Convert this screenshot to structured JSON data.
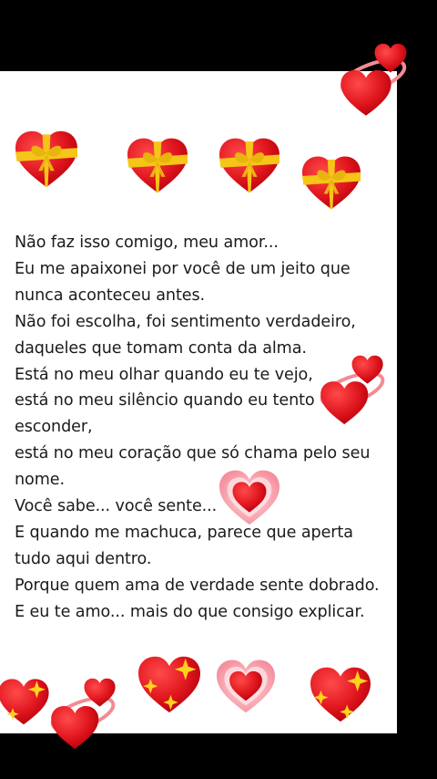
{
  "poem_lines": [
    "Não faz isso comigo, meu amor...",
    "Eu me apaixonei por você de um jeito que",
    "nunca aconteceu antes.",
    "Não foi escolha, foi sentimento verdadeiro,",
    "daqueles que tomam conta da alma.",
    "Está no meu olhar quando eu te vejo,",
    "está no meu silêncio quando eu tento",
    "esconder,",
    "está no meu coração que só chama pelo seu",
    "nome.",
    "Você sabe... você sente...",
    "E quando me machuca, parece que aperta",
    "tudo aqui dentro.",
    "Porque quem ama de verdade sente dobrado.",
    "E eu te amo... mais do que consigo explicar."
  ],
  "decorations": {
    "top_row": [
      "gift-heart-icon",
      "gift-heart-icon",
      "gift-heart-icon",
      "gift-heart-icon"
    ],
    "bottom_row": [
      "sparkling-heart-icon",
      "revolving-hearts-icon",
      "sparkling-heart-icon",
      "growing-heart-icon",
      "sparkling-heart-icon"
    ],
    "inline": [
      "revolving-hearts-icon",
      "revolving-hearts-icon",
      "growing-heart-icon"
    ]
  },
  "colors": {
    "heart_red": "#e0161e",
    "ribbon_yellow": "#f5c518",
    "sparkle_yellow": "#ffd21f",
    "glow_pink": "#f7a0a8",
    "text": "#1b1b1b"
  }
}
